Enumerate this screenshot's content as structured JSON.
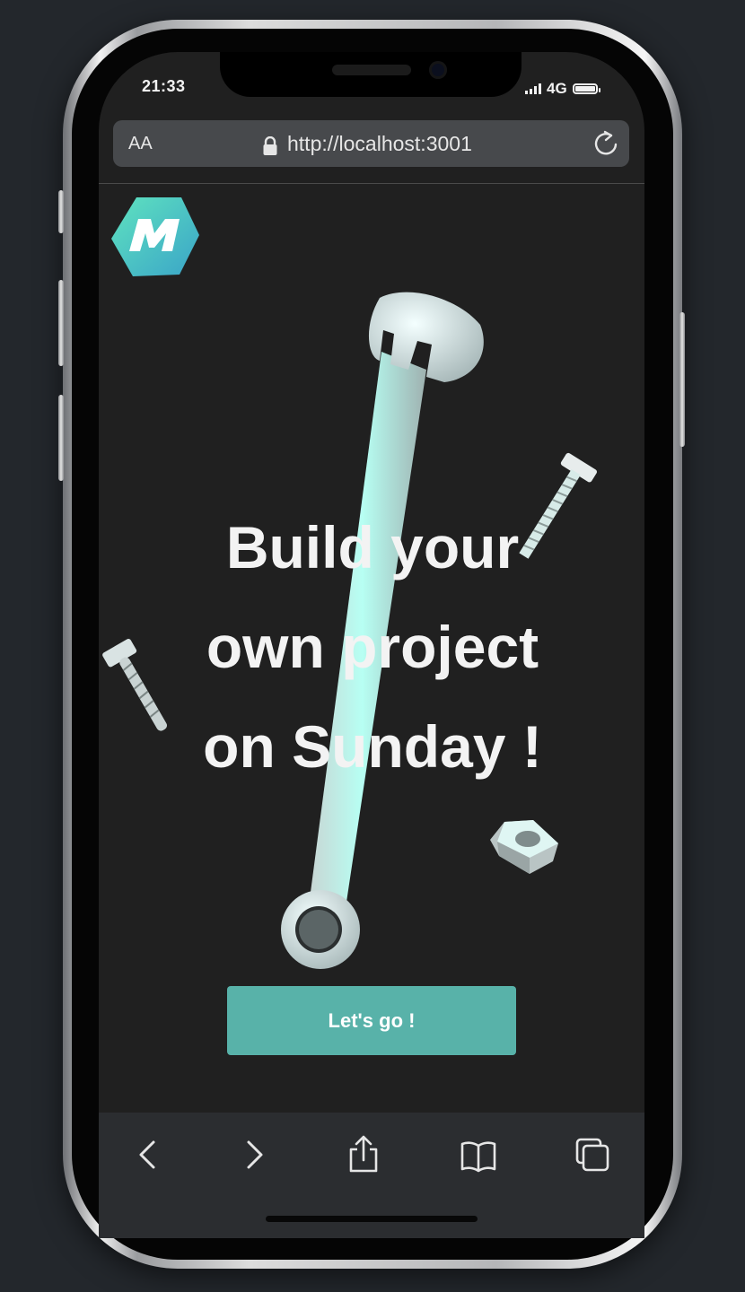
{
  "status_bar": {
    "time": "21:33",
    "network": "4G"
  },
  "browser": {
    "text_size_label": "AA",
    "url": "http://localhost:3001"
  },
  "page": {
    "logo_letter": "M",
    "headline_lines": [
      "Build your",
      "own project",
      "on Sunday !"
    ],
    "cta_label": "Let's go !"
  },
  "toolbar": {
    "icons": [
      "back-icon",
      "forward-icon",
      "share-icon",
      "bookmarks-icon",
      "tabs-icon"
    ]
  },
  "colors": {
    "background": "#202020",
    "accent_button": "#58b2a9",
    "logo_gradient_start": "#5de0c0",
    "logo_gradient_end": "#3aa7c9"
  }
}
